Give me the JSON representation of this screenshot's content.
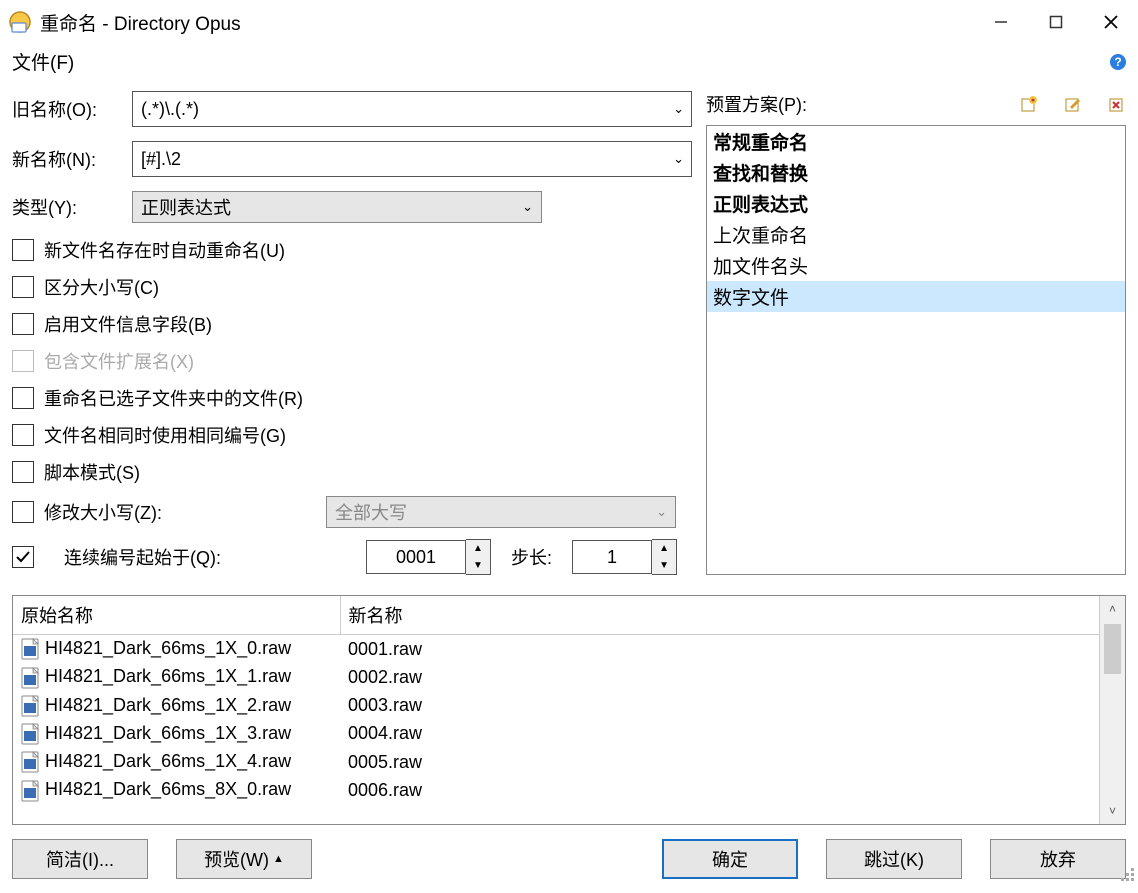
{
  "title": "重命名 - Directory Opus",
  "menubar": {
    "file": "文件(F)",
    "help_tooltip": "?"
  },
  "form": {
    "old_name_label": "旧名称(O):",
    "old_name_value": "(.*)\\.(.*)",
    "new_name_label": "新名称(N):",
    "new_name_value": "[#].\\2",
    "type_label": "类型(Y):",
    "type_value": "正则表达式"
  },
  "checks": {
    "auto_rename": "新文件名存在时自动重命名(U)",
    "case_sensitive": "区分大小写(C)",
    "use_fileinfo": "启用文件信息字段(B)",
    "include_ext": "包含文件扩展名(X)",
    "rename_subfolders": "重命名已选子文件夹中的文件(R)",
    "same_number": "文件名相同时使用相同编号(G)",
    "script_mode": "脚本模式(S)",
    "modify_case": "修改大小写(Z):",
    "case_option": "全部大写",
    "seq_start": "连续编号起始于(Q):",
    "seq_start_value": "0001",
    "step_label": "步长:",
    "step_value": "1"
  },
  "presets": {
    "label": "预置方案(P):",
    "add_icon": "add-preset-icon",
    "edit_icon": "edit-preset-icon",
    "delete_icon": "delete-preset-icon",
    "items": [
      {
        "label": "常规重命名",
        "bold": true
      },
      {
        "label": "查找和替换",
        "bold": true
      },
      {
        "label": "正则表达式",
        "bold": true
      },
      {
        "label": "上次重命名",
        "bold": false
      },
      {
        "label": "加文件名头",
        "bold": false
      },
      {
        "label": "数字文件",
        "bold": false,
        "selected": true
      }
    ]
  },
  "preview": {
    "col1": "原始名称",
    "col2": "新名称",
    "rows": [
      {
        "orig": "HI4821_Dark_66ms_1X_0.raw",
        "new": "0001.raw"
      },
      {
        "orig": "HI4821_Dark_66ms_1X_1.raw",
        "new": "0002.raw"
      },
      {
        "orig": "HI4821_Dark_66ms_1X_2.raw",
        "new": "0003.raw"
      },
      {
        "orig": "HI4821_Dark_66ms_1X_3.raw",
        "new": "0004.raw"
      },
      {
        "orig": "HI4821_Dark_66ms_1X_4.raw",
        "new": "0005.raw"
      },
      {
        "orig": "HI4821_Dark_66ms_8X_0.raw",
        "new": "0006.raw"
      }
    ]
  },
  "buttons": {
    "simple": "简洁(I)...",
    "preview": "预览(W)",
    "ok": "确定",
    "skip": "跳过(K)",
    "abandon": "放弃"
  }
}
